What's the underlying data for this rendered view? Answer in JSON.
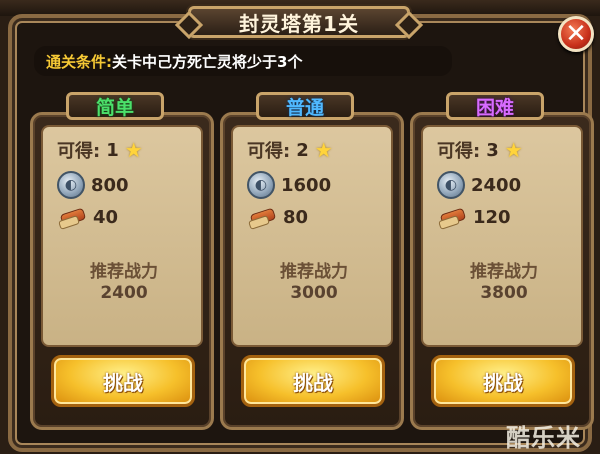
{
  "dialog": {
    "title": "封灵塔第1关",
    "close_symbol": "✕",
    "condition_label": "通关条件:",
    "condition_text": " 关卡中己方死亡灵将少于3个"
  },
  "levels": [
    {
      "difficulty": "简单",
      "difficulty_color": "#4be06a",
      "gain_label": "可得:",
      "stars": "1",
      "coins": "800",
      "scrolls": "40",
      "power_label": "推荐战力",
      "power_value": "2400",
      "button_label": "挑战"
    },
    {
      "difficulty": "普通",
      "difficulty_color": "#4fb8ff",
      "gain_label": "可得:",
      "stars": "2",
      "coins": "1600",
      "scrolls": "80",
      "power_label": "推荐战力",
      "power_value": "3000",
      "button_label": "挑战"
    },
    {
      "difficulty": "困难",
      "difficulty_color": "#d76bff",
      "gain_label": "可得:",
      "stars": "3",
      "coins": "2400",
      "scrolls": "120",
      "power_label": "推荐战力",
      "power_value": "3800",
      "button_label": "挑战"
    }
  ],
  "watermark": "酷乐米",
  "icons": {
    "star": "star-icon",
    "coin": "silver-coin-icon",
    "scroll": "scroll-icon"
  }
}
